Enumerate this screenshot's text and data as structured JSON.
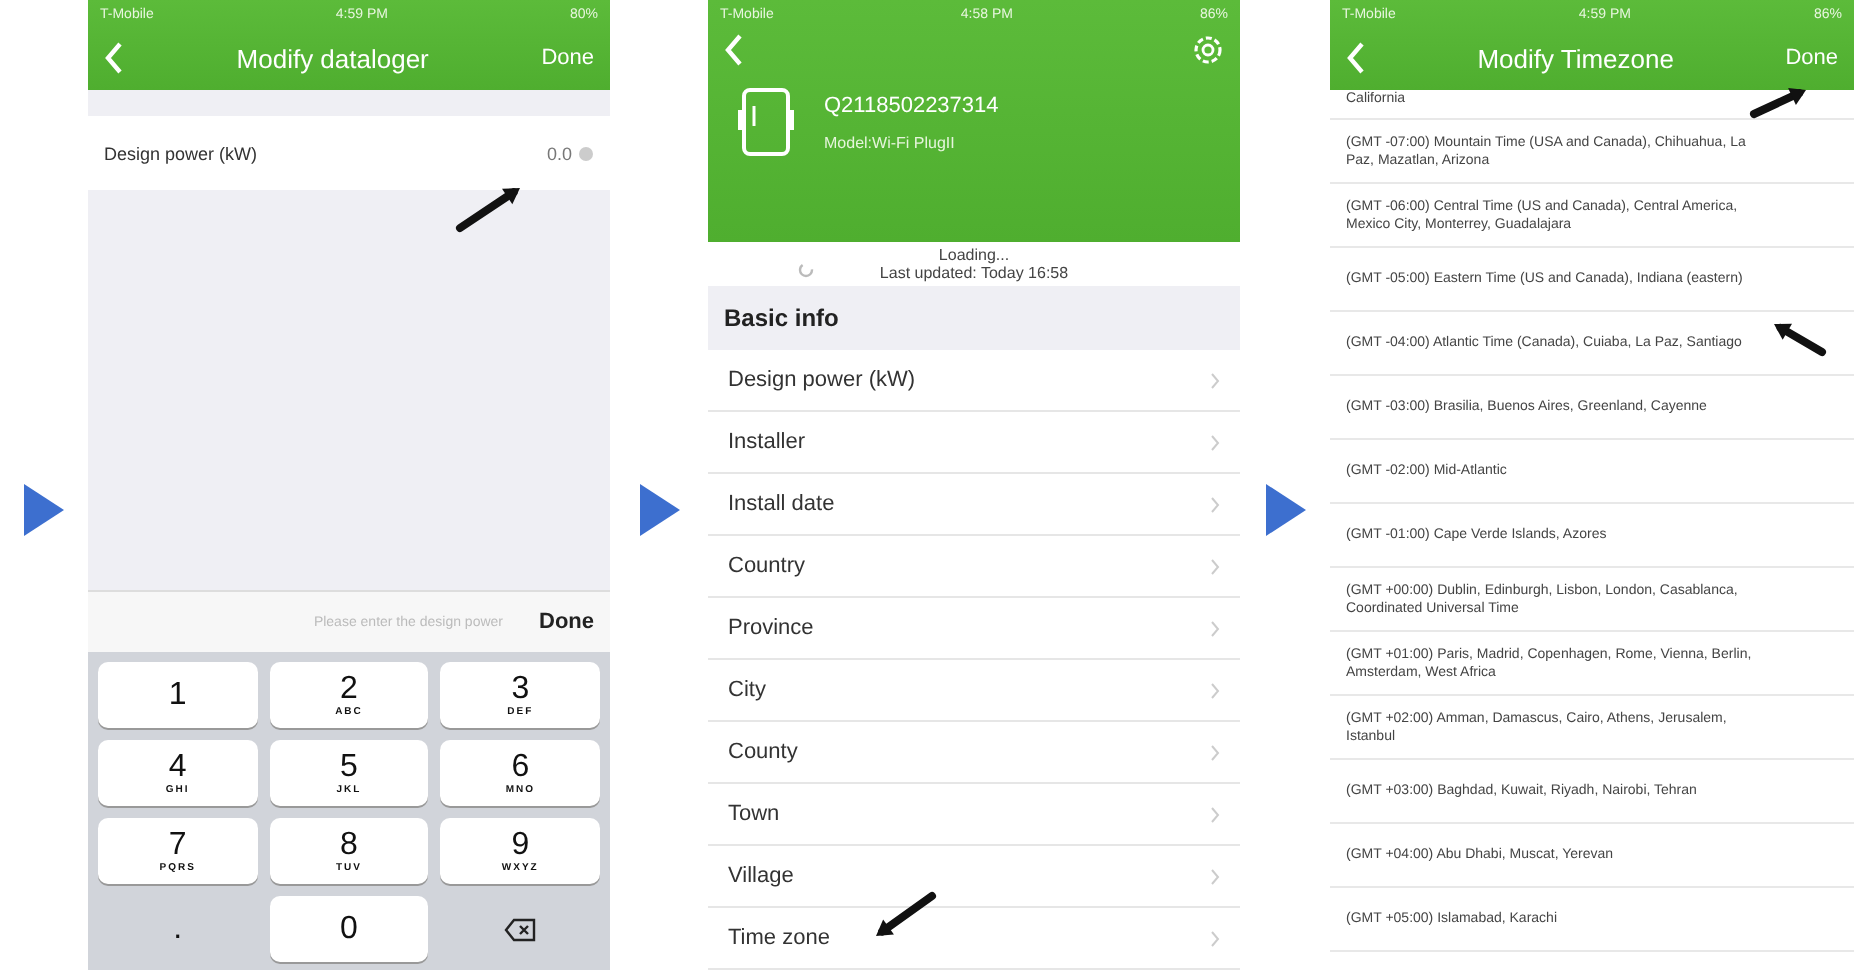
{
  "screens": [
    {
      "kind": "datalogger",
      "status_bar": {
        "carrier": "T-Mobile",
        "time": "4:59 PM",
        "battery": "80%"
      },
      "nav": {
        "title": "Modify dataloger",
        "action": "Done"
      },
      "field": {
        "label": "Design power (kW)",
        "value": "0.0"
      },
      "keyboard_bar": {
        "placeholder": "Please enter the design power",
        "action": "Done"
      },
      "keys": [
        {
          "kind": "digit",
          "digit": "1"
        },
        {
          "kind": "digit",
          "digit": "2",
          "letters": "ABC"
        },
        {
          "kind": "digit",
          "digit": "3",
          "letters": "DEF"
        },
        {
          "kind": "digit",
          "digit": "4",
          "letters": "GHI"
        },
        {
          "kind": "digit",
          "digit": "5",
          "letters": "JKL"
        },
        {
          "kind": "digit",
          "digit": "6",
          "letters": "MNO"
        },
        {
          "kind": "digit",
          "digit": "7",
          "letters": "PQRS"
        },
        {
          "kind": "digit",
          "digit": "8",
          "letters": "TUV"
        },
        {
          "kind": "digit",
          "digit": "9",
          "letters": "WXYZ"
        },
        {
          "kind": "symbol",
          "digit": "."
        },
        {
          "kind": "digit",
          "digit": "0"
        },
        {
          "kind": "delete"
        }
      ]
    },
    {
      "kind": "device",
      "status_bar": {
        "carrier": "T-Mobile",
        "time": "4:58 PM",
        "battery": "86%"
      },
      "device": {
        "serial": "Q2118502237314",
        "model": "Model:Wi-Fi PlugII"
      },
      "loading": "Loading...",
      "updated": "Last updated: Today 16:58",
      "section": "Basic info",
      "rows": [
        "Design power (kW)",
        "Installer",
        "Install date",
        "Country",
        "Province",
        "City",
        "County",
        "Town",
        "Village",
        "Time zone"
      ]
    },
    {
      "kind": "timezone",
      "status_bar": {
        "carrier": "T-Mobile",
        "time": "4:59 PM",
        "battery": "86%"
      },
      "nav": {
        "title": "Modify Timezone",
        "action": "Done"
      },
      "zones": [
        "California",
        "(GMT -07:00) Mountain Time (USA and Canada), Chihuahua, La Paz, Mazatlan, Arizona",
        "(GMT -06:00) Central Time (US and Canada), Central America, Mexico City, Monterrey, Guadalajara",
        "(GMT -05:00) Eastern Time (US and Canada), Indiana (eastern)",
        "(GMT -04:00) Atlantic Time (Canada), Cuiaba, La Paz, Santiago",
        "(GMT -03:00) Brasilia, Buenos Aires, Greenland, Cayenne",
        "(GMT -02:00) Mid-Atlantic",
        "(GMT -01:00) Cape Verde Islands, Azores",
        "(GMT +00:00) Dublin, Edinburgh, Lisbon, London, Casablanca, Coordinated Universal Time",
        "(GMT +01:00) Paris, Madrid, Copenhagen, Rome, Vienna, Berlin, Amsterdam, West Africa",
        "(GMT +02:00) Amman, Damascus, Cairo, Athens, Jerusalem, Istanbul",
        "(GMT +03:00) Baghdad, Kuwait, Riyadh, Nairobi, Tehran",
        "(GMT +04:00) Abu Dhabi, Muscat, Yerevan",
        "(GMT +05:00) Islamabad, Karachi"
      ]
    }
  ]
}
